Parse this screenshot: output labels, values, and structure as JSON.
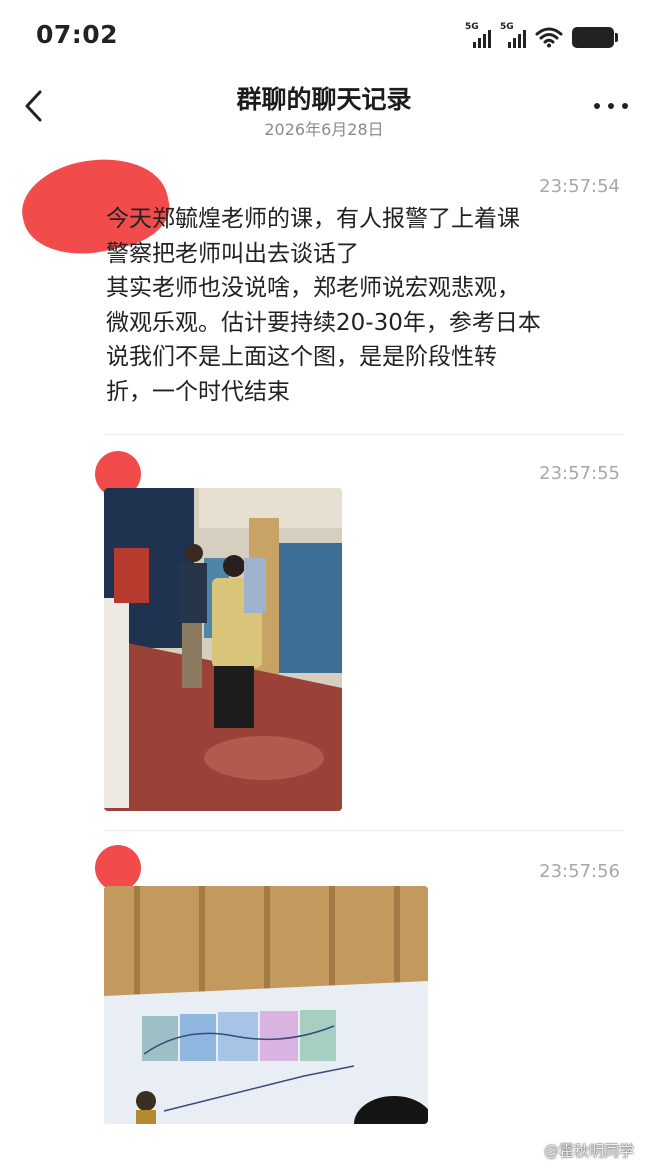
{
  "status_bar": {
    "time": "07:02",
    "sig1_label": "5G",
    "sig2_label": "5G"
  },
  "header": {
    "title": "群聊的聊天记录",
    "date": "2026年6月28日"
  },
  "messages": [
    {
      "timestamp": "23:57:54",
      "lines": [
        "今天郑毓煌老师的课，有人报警了上着课",
        "警察把老师叫出去谈话了",
        "其实老师也没说啥，郑老师说宏观悲观，",
        "微观乐观。估计要持续20-30年，参考日本",
        "说我们不是上面这个图，是是阶段性转",
        "折，一个时代结束"
      ]
    },
    {
      "timestamp": "23:57:55",
      "image": "lobby-photo"
    },
    {
      "timestamp": "23:57:56",
      "image": "lecture-slide-photo"
    }
  ],
  "watermark": "@霍秋明同学",
  "colors": {
    "redaction": "#f24b4b",
    "timestamp": "#a8a8a8",
    "date": "#8b8b8b"
  }
}
